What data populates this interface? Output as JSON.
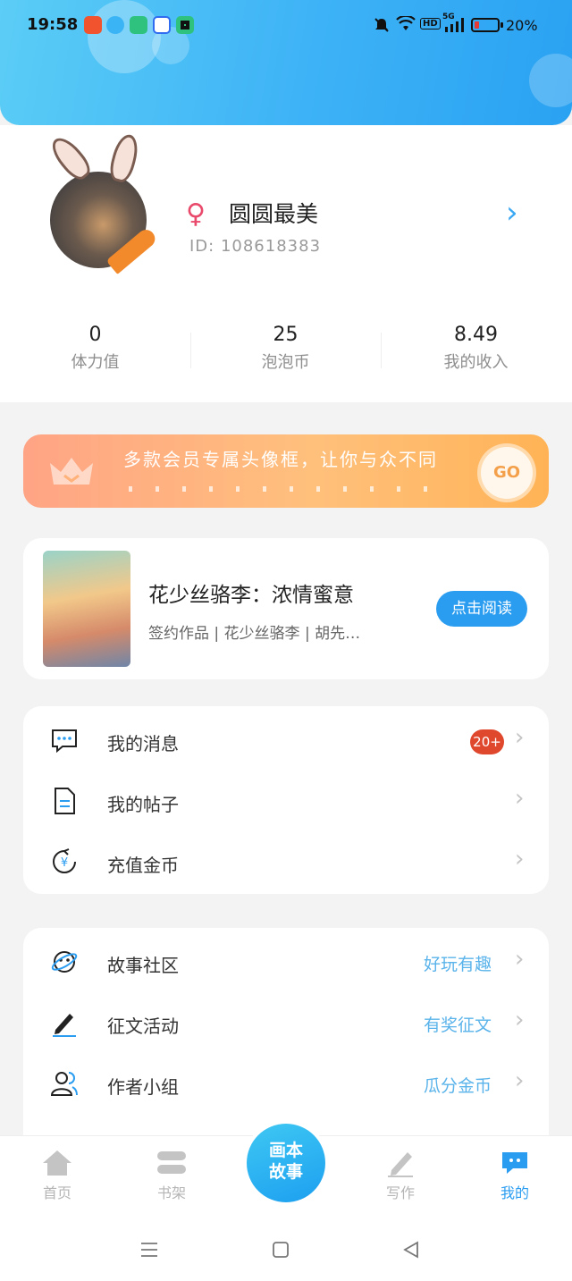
{
  "status_bar": {
    "time": "19:58",
    "battery_percent": "20%",
    "signal_label": "5G",
    "hd_label": "HD",
    "notification_icons": [
      "app-red-icon",
      "qq-icon",
      "green-app-icon",
      "baidu-icon",
      "camera-app-icon"
    ],
    "battery_level": 0.2
  },
  "profile": {
    "nickname": "圆圆最美",
    "user_id": "ID: 108618383",
    "gender_icon": "female-icon"
  },
  "stats": [
    {
      "value": "0",
      "label": "体力值"
    },
    {
      "value": "25",
      "label": "泡泡币"
    },
    {
      "value": "8.49",
      "label": "我的收入"
    }
  ],
  "vip_banner": {
    "text": "多款会员专属头像框，让你与众不同",
    "go_label": "GO"
  },
  "book": {
    "title": "花少丝骆李：浓情蜜意",
    "meta": "签约作品 | 花少丝骆李 | 胡先…",
    "read_label": "点击阅读"
  },
  "menu_primary": [
    {
      "label": "我的消息",
      "badge": "20+",
      "icon": "message-icon"
    },
    {
      "label": "我的帖子",
      "icon": "document-icon"
    },
    {
      "label": "充值金币",
      "icon": "coin-recharge-icon"
    }
  ],
  "menu_secondary": [
    {
      "label": "故事社区",
      "hint": "好玩有趣",
      "icon": "planet-icon"
    },
    {
      "label": "征文活动",
      "hint": "有奖征文",
      "icon": "pen-icon"
    },
    {
      "label": "作者小组",
      "hint": "瓜分金币",
      "icon": "group-icon"
    }
  ],
  "tabbar": {
    "home": "首页",
    "shelf": "书架",
    "center_line1": "画本",
    "center_line2": "故事",
    "write": "写作",
    "mine": "我的"
  },
  "colors": {
    "accent": "#2b9df0",
    "header_gradient_start": "#5bcdf6",
    "header_gradient_end": "#2aa2f2",
    "badge": "#e0482e",
    "vip_start": "#ffa485",
    "vip_end": "#ffb356"
  }
}
